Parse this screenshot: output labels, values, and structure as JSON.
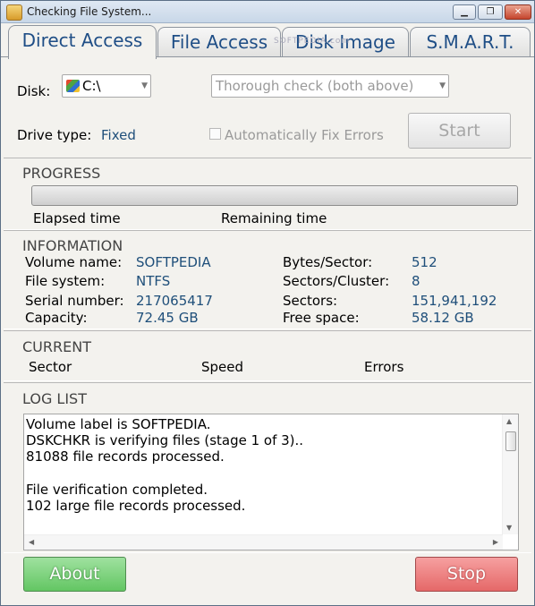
{
  "window": {
    "title": "Checking File System...",
    "minimize_glyph": "▁",
    "maximize_glyph": "❐",
    "close_glyph": "✕"
  },
  "watermark": "SOFTPEDIA.com",
  "tabs": [
    {
      "label": "Direct Access"
    },
    {
      "label": "File Access"
    },
    {
      "label": "Disk Image"
    },
    {
      "label": "S.M.A.R.T."
    }
  ],
  "disk": {
    "label": "Disk:",
    "value": "C:\\",
    "icon": "windows-drive-icon"
  },
  "check_mode": {
    "value": "Thorough check (both above)"
  },
  "drive_type": {
    "label": "Drive type:",
    "value": "Fixed"
  },
  "auto_fix": {
    "label": "Automatically Fix Errors",
    "checked": false
  },
  "start_button": "Start",
  "progress": {
    "title": "PROGRESS",
    "value": 0,
    "elapsed_label": "Elapsed time",
    "remaining_label": "Remaining time"
  },
  "information": {
    "title": "INFORMATION",
    "volume_name": {
      "label": "Volume name:",
      "value": "SOFTPEDIA"
    },
    "file_system": {
      "label": "File system:",
      "value": "NTFS"
    },
    "serial_number": {
      "label": "Serial number:",
      "value": "217065417"
    },
    "capacity": {
      "label": "Capacity:",
      "value": "72.45 GB"
    },
    "bytes_per_sector": {
      "label": "Bytes/Sector:",
      "value": "512"
    },
    "sectors_per_cluster": {
      "label": "Sectors/Cluster:",
      "value": "8"
    },
    "sectors": {
      "label": "Sectors:",
      "value": "151,941,192"
    },
    "free_space": {
      "label": "Free space:",
      "value": "58.12 GB"
    }
  },
  "current": {
    "title": "CURRENT",
    "sector_label": "Sector",
    "speed_label": "Speed",
    "errors_label": "Errors"
  },
  "log": {
    "title": "LOG LIST",
    "lines": [
      "Volume label is SOFTPEDIA.",
      "DSKCHKR is verifying files (stage 1 of 3)..",
      "81088 file records processed.",
      "",
      "File verification completed.",
      "102 large file records processed."
    ]
  },
  "about_button": "About",
  "stop_button": "Stop"
}
